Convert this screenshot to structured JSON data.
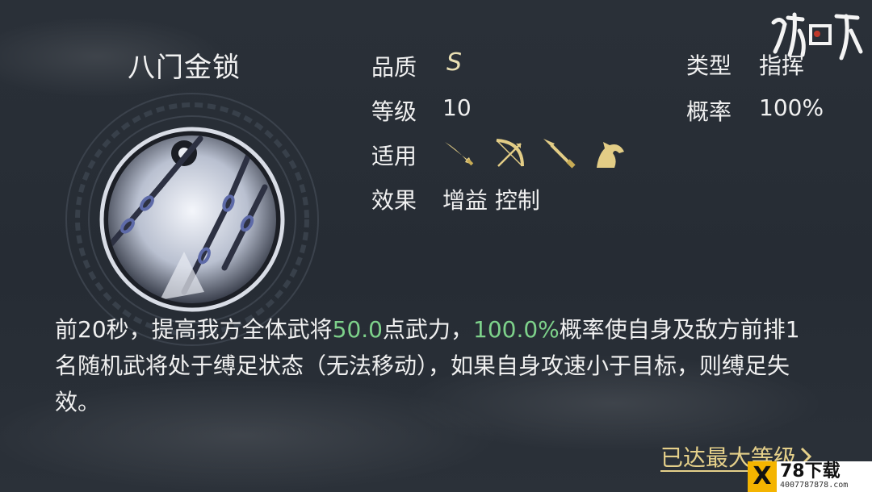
{
  "skill": {
    "name": "八门金锁"
  },
  "attributes": {
    "quality_label": "品质",
    "quality_value": "S",
    "level_label": "等级",
    "level_value": "10",
    "applicable_label": "适用",
    "applicable_units": [
      "sword-icon",
      "bow-icon",
      "spear-icon",
      "horse-icon"
    ],
    "effect_label": "效果",
    "effect_value": "增益 控制",
    "type_label": "类型",
    "type_value": "指挥",
    "chance_label": "概率",
    "chance_value": "100%"
  },
  "description": {
    "part1": "前20秒，提高我方全体武将",
    "value1": "50.0",
    "part2": "点武力，",
    "value2": "100.0%",
    "part3": "概率使自身及敌方前排1名随机武将处于缚足状态（无法移动），如果自身攻速小于目标，则缚足失效。"
  },
  "footer": {
    "max_level_label": "已达最大等级"
  },
  "watermark": {
    "brand": "78下载",
    "sub": "4007787878.com"
  },
  "colors": {
    "highlight_green": "#7dd18a",
    "gold": "#e5d08a",
    "background": "#272d35"
  }
}
